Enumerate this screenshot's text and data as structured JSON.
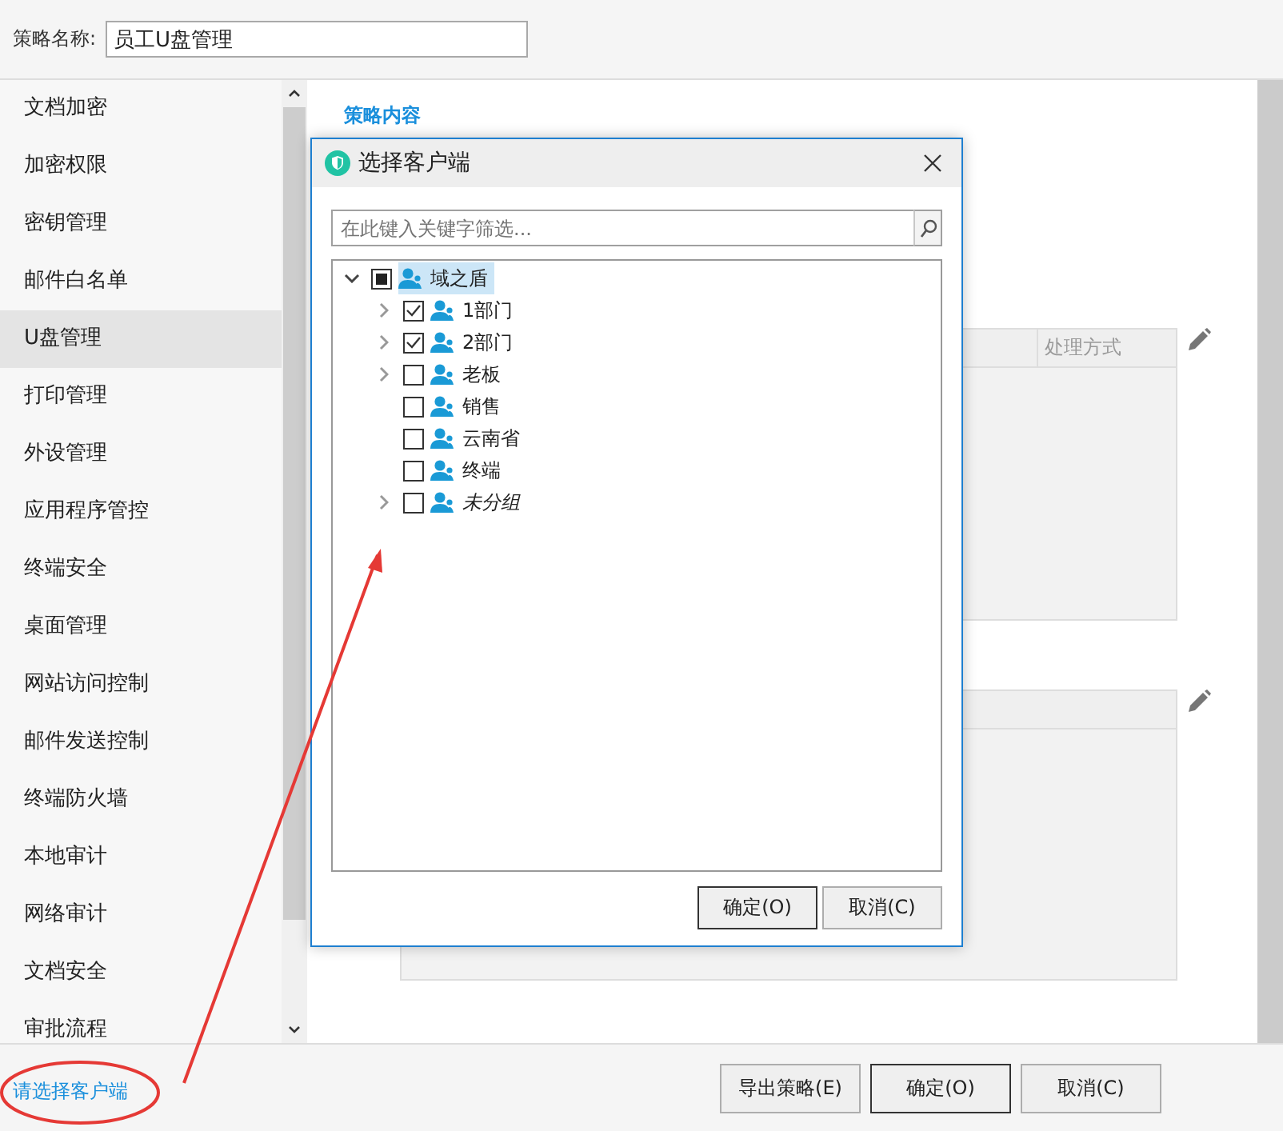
{
  "policy_name": {
    "label": "策略名称:",
    "value": "员工U盘管理"
  },
  "sidebar": {
    "items": [
      {
        "label": "文档加密",
        "selected": false
      },
      {
        "label": "加密权限",
        "selected": false
      },
      {
        "label": "密钥管理",
        "selected": false
      },
      {
        "label": "邮件白名单",
        "selected": false
      },
      {
        "label": "U盘管理",
        "selected": true
      },
      {
        "label": "打印管理",
        "selected": false
      },
      {
        "label": "外设管理",
        "selected": false
      },
      {
        "label": "应用程序管控",
        "selected": false
      },
      {
        "label": "终端安全",
        "selected": false
      },
      {
        "label": "桌面管理",
        "selected": false
      },
      {
        "label": "网站访问控制",
        "selected": false
      },
      {
        "label": "邮件发送控制",
        "selected": false
      },
      {
        "label": "终端防火墙",
        "selected": false
      },
      {
        "label": "本地审计",
        "selected": false
      },
      {
        "label": "网络审计",
        "selected": false
      },
      {
        "label": "文档安全",
        "selected": false
      },
      {
        "label": "审批流程",
        "selected": false
      }
    ]
  },
  "content": {
    "section_title": "策略内容",
    "table_column": "处理方式"
  },
  "dialog": {
    "title": "选择客户端",
    "search": {
      "placeholder": "在此键入关键字筛选..."
    },
    "tree": [
      {
        "label": "域之盾",
        "checked": false,
        "partial": true,
        "expanded": true,
        "selected": true,
        "italic": false,
        "children": [
          {
            "label": "1部门",
            "checked": true,
            "expanded": false,
            "selected": false,
            "italic": false
          },
          {
            "label": "2部门",
            "checked": true,
            "expanded": false,
            "selected": false,
            "italic": false
          },
          {
            "label": "老板",
            "checked": false,
            "expanded": false,
            "selected": false,
            "italic": false
          },
          {
            "label": "销售",
            "checked": false,
            "selected": false,
            "italic": false
          },
          {
            "label": "云南省",
            "checked": false,
            "selected": false,
            "italic": false
          },
          {
            "label": "终端",
            "checked": false,
            "selected": false,
            "italic": false
          },
          {
            "label": "未分组",
            "checked": false,
            "expanded": false,
            "selected": false,
            "italic": true
          }
        ]
      }
    ],
    "buttons": [
      "确定(O)",
      "取消(C)"
    ]
  },
  "footer": {
    "link": "请选择客户端",
    "buttons": [
      "导出策略(E)",
      "确定(O)",
      "取消(C)"
    ]
  }
}
